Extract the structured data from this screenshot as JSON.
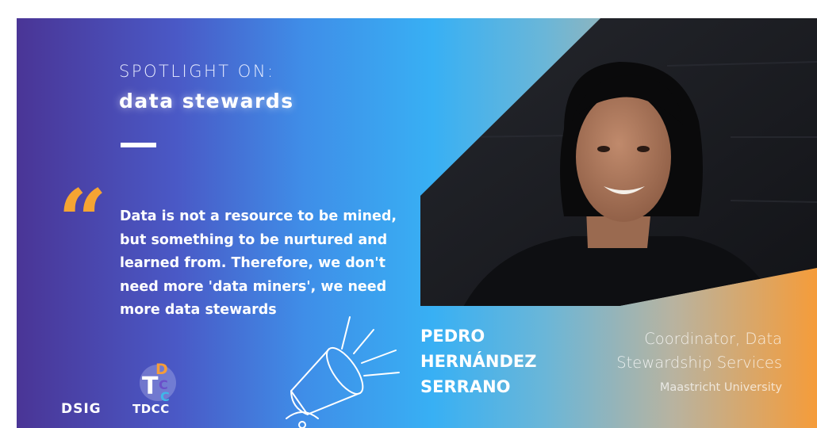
{
  "header": {
    "eyebrow": "SPOTLIGHT ON:",
    "headline": "data stewards"
  },
  "quote": {
    "mark": "“",
    "text": "Data is not a resource to be mined, but something to be nurtured and learned from. Therefore, we don't need more 'data miners', we need more data stewards"
  },
  "person": {
    "name_lines": [
      "PEDRO",
      "HERNÁNDEZ",
      "SERRANO"
    ],
    "role_lines": [
      "Coordinator, Data",
      "Stewardship Services"
    ],
    "organization": "Maastricht University"
  },
  "logos": {
    "dsig": "DSIG",
    "tdcc": "TDCC",
    "tdcc_mark_letters": [
      "D",
      "T",
      "C",
      "C"
    ]
  },
  "icons": [
    "spotlight-icon",
    "quote-mark-icon",
    "tdcc-logo-icon"
  ],
  "colors": {
    "gradient": [
      "#4a3596",
      "#3f8ee8",
      "#38b0f4",
      "#f59c3a"
    ],
    "quote_accent": "#f5a433",
    "photo_background": "#1a1c21"
  }
}
